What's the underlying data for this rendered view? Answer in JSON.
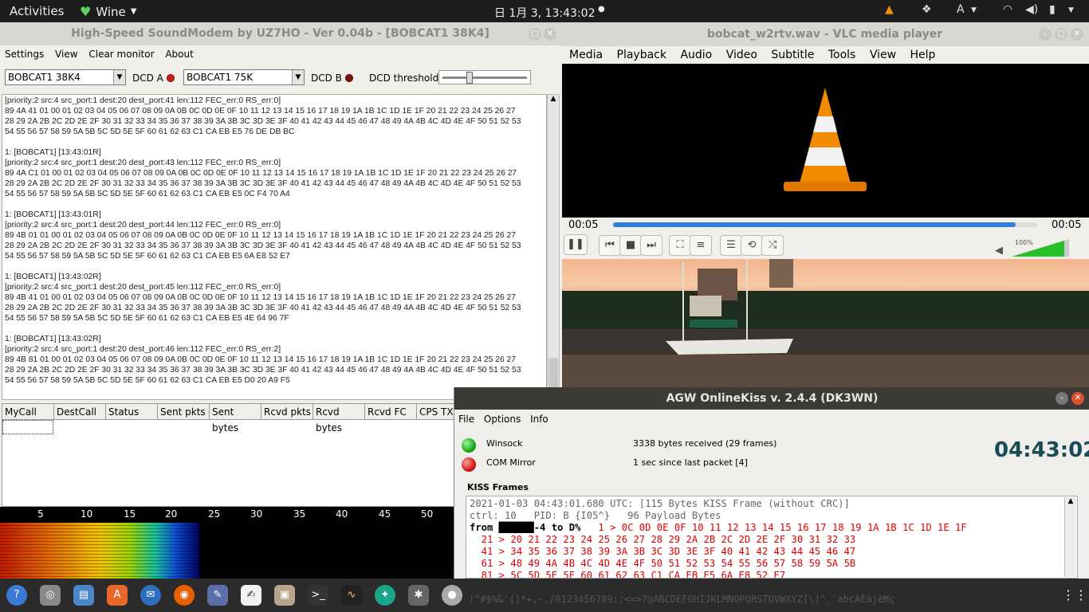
{
  "topbar": {
    "activities": "Activities",
    "app": "Wine",
    "clock": "日 1月  3, 13:43:02",
    "keyboard": "A"
  },
  "soundmodem": {
    "title": "High-Speed SoundModem by UZ7HO - Ver 0.04b - [BOBCAT1 38K4]",
    "menu": [
      "Settings",
      "View",
      "Clear monitor",
      "About"
    ],
    "modem_a": "BOBCAT1 38K4",
    "dcd_a": "DCD A",
    "modem_b": "BOBCAT1 75K",
    "dcd_b": "DCD B",
    "dcd_threshold": "DCD threshold",
    "monitor_text": "[priority:2 src:4 src_port:1 dest:20 dest_port:41 len:112 FEC_err:0 RS_err:0]\n89 4A 41 01 00 01 02 03 04 05 06 07 08 09 0A 0B 0C 0D 0E 0F 10 11 12 13 14 15 16 17 18 19 1A 1B 1C 1D 1E 1F 20 21 22 23 24 25 26 27\n28 29 2A 2B 2C 2D 2E 2F 30 31 32 33 34 35 36 37 38 39 3A 3B 3C 3D 3E 3F 40 41 42 43 44 45 46 47 48 49 4A 4B 4C 4D 4E 4F 50 51 52 53\n54 55 56 57 58 59 5A 5B 5C 5D 5E 5F 60 61 62 63 C1 CA EB E5 76 DE DB BC\n\n1: [BOBCAT1] [13:43:01R]\n[priority:2 src:4 src_port:1 dest:20 dest_port:43 len:112 FEC_err:0 RS_err:0]\n89 4A C1 01 00 01 02 03 04 05 06 07 08 09 0A 0B 0C 0D 0E 0F 10 11 12 13 14 15 16 17 18 19 1A 1B 1C 1D 1E 1F 20 21 22 23 24 25 26 27\n28 29 2A 2B 2C 2D 2E 2F 30 31 32 33 34 35 36 37 38 39 3A 3B 3C 3D 3E 3F 40 41 42 43 44 45 46 47 48 49 4A 4B 4C 4D 4E 4F 50 51 52 53\n54 55 56 57 58 59 5A 5B 5C 5D 5E 5F 60 61 62 63 C1 CA EB E5 0C F4 70 A4\n\n1: [BOBCAT1] [13:43:01R]\n[priority:2 src:4 src_port:1 dest:20 dest_port:44 len:112 FEC_err:0 RS_err:0]\n89 4B 01 01 00 01 02 03 04 05 06 07 08 09 0A 0B 0C 0D 0E 0F 10 11 12 13 14 15 16 17 18 19 1A 1B 1C 1D 1E 1F 20 21 22 23 24 25 26 27\n28 29 2A 2B 2C 2D 2E 2F 30 31 32 33 34 35 36 37 38 39 3A 3B 3C 3D 3E 3F 40 41 42 43 44 45 46 47 48 49 4A 4B 4C 4D 4E 4F 50 51 52 53\n54 55 56 57 58 59 5A 5B 5C 5D 5E 5F 60 61 62 63 C1 CA EB E5 6A E8 52 E7\n\n1: [BOBCAT1] [13:43:02R]\n[priority:2 src:4 src_port:1 dest:20 dest_port:45 len:112 FEC_err:0 RS_err:0]\n89 4B 41 01 00 01 02 03 04 05 06 07 08 09 0A 0B 0C 0D 0E 0F 10 11 12 13 14 15 16 17 18 19 1A 1B 1C 1D 1E 1F 20 21 22 23 24 25 26 27\n28 29 2A 2B 2C 2D 2E 2F 30 31 32 33 34 35 36 37 38 39 3A 3B 3C 3D 3E 3F 40 41 42 43 44 45 46 47 48 49 4A 4B 4C 4D 4E 4F 50 51 52 53\n54 55 56 57 58 59 5A 5B 5C 5D 5E 5F 60 61 62 63 C1 CA EB E5 4E 64 96 7F\n\n1: [BOBCAT1] [13:43:02R]\n[priority:2 src:4 src_port:1 dest:20 dest_port:46 len:112 FEC_err:0 RS_err:2]\n89 4B 81 01 00 01 02 03 04 05 06 07 08 09 0A 0B 0C 0D 0E 0F 10 11 12 13 14 15 16 17 18 19 1A 1B 1C 1D 1E 1F 20 21 22 23 24 25 26 27\n28 29 2A 2B 2C 2D 2E 2F 30 31 32 33 34 35 36 37 38 39 3A 3B 3C 3D 3E 3F 40 41 42 43 44 45 46 47 48 49 4A 4B 4C 4D 4E 4F 50 51 52 53\n54 55 56 57 58 59 5A 5B 5C 5D 5E 5F 60 61 62 63 C1 CA EB E5 D0 20 A9 F5",
    "columns": [
      "MyCall",
      "DestCall",
      "Status",
      "Sent pkts",
      "Sent bytes",
      "Rcvd pkts",
      "Rcvd bytes",
      "Rcvd FC",
      "CPS TX"
    ],
    "scale": [
      "5",
      "10",
      "15",
      "20",
      "25",
      "30",
      "35",
      "40",
      "45",
      "50"
    ]
  },
  "vlc": {
    "title": "bobcat_w2rtv.wav - VLC media player",
    "menu": [
      "Media",
      "Playback",
      "Audio",
      "Video",
      "Subtitle",
      "Tools",
      "View",
      "Help"
    ],
    "time_elapsed": "00:05",
    "time_total": "00:05",
    "progress": 0.95,
    "volume_label": "100%"
  },
  "agw": {
    "title": "AGW OnlineKiss v. 2.4.4  (DK3WN)",
    "menu": [
      "File",
      "Options",
      "Info"
    ],
    "winsock_label": "Winsock",
    "winsock_status": "3338 bytes received (29 frames)",
    "com_label": "COM Mirror",
    "com_status": "1 sec since last packet [4]",
    "clock": "04:43:02",
    "kiss_group": "KISS Frames",
    "kiss_line1": "2021-01-03 04:43:01.680 UTC: [115 Bytes KISS Frame (without CRC)]",
    "kiss_line2": "ctrl: 10   PID: B {I05^}   96 Payload Bytes",
    "kiss_from": "from ██████-4 to D%",
    "kiss_row1": "   1 > 0C 0D 0E 0F 10 11 12 13 14 15 16 17 18 19 1A 1B 1C 1D 1E 1F",
    "kiss_row2": "  21 > 20 21 22 23 24 25 26 27 28 29 2A 2B 2C 2D 2E 2F 30 31 32 33",
    "kiss_row3": "  41 > 34 35 36 37 38 39 3A 3B 3C 3D 3E 3F 40 41 42 43 44 45 46 47",
    "kiss_row4": "  61 > 48 49 4A 4B 4C 4D 4E 4F 50 51 52 53 54 55 56 57 58 59 5A 5B",
    "kiss_row5": "  81 > 5C 5D 5E 5F 60 61 62 63 C1 CA EB E5 6A E8 52 E7",
    "ascii_line": "!\"#$%&'()*+,-./0123456789:;<=>?@ABCDEFGHIJKLMNOPQRSTUVWXYZ[\\]^_`abcÁËâjèĦç"
  }
}
